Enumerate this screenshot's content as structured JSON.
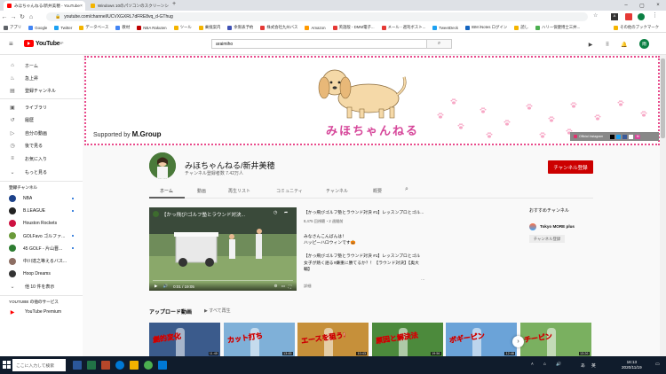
{
  "browser": {
    "tabs": [
      {
        "title": "みほちゃんねる/新井美穂 - YouTube",
        "active": true
      },
      {
        "title": "Windows 10のパソコンのスクリーンシ",
        "active": false
      }
    ],
    "url": "youtube.com/channel/UCVXGXRL7dFRE8vq_d-GThug",
    "bookmarks": [
      "アプリ",
      "Google",
      "Twitter",
      "データベース",
      "教材",
      "NBA Rakuten",
      "ツール",
      "乗換案内",
      "余限表予約",
      "株式会社九州バス",
      "Amazon",
      "英語版 - DMM電子...",
      "メール - 週刊ボスト...",
      "TweetDeck",
      "IBM iNotes ログイン",
      "読し",
      "ハリー保健博士三井...",
      "その他のブックマーク"
    ]
  },
  "youtube": {
    "logo_text": "YouTube",
    "logo_sup": "JP",
    "search_value": "araimiho",
    "avatar_letter": "雨"
  },
  "sidebar": {
    "main": [
      {
        "label": "ホーム",
        "icon": "home-icon",
        "glyph": "⌂",
        "active": false
      },
      {
        "label": "急上昇",
        "icon": "flame-icon",
        "glyph": "♨",
        "active": false
      },
      {
        "label": "登録チャンネル",
        "icon": "subscriptions-icon",
        "glyph": "▤",
        "active": false
      }
    ],
    "library": [
      {
        "label": "ライブラリ",
        "icon": "library-icon",
        "glyph": "▣"
      },
      {
        "label": "履歴",
        "icon": "history-icon",
        "glyph": "↺"
      },
      {
        "label": "自分の動画",
        "icon": "my-videos-icon",
        "glyph": "▷"
      },
      {
        "label": "後で見る",
        "icon": "watch-later-icon",
        "glyph": "◷"
      },
      {
        "label": "お気に入り",
        "icon": "favorites-icon",
        "glyph": "≡"
      },
      {
        "label": "もっと見る",
        "icon": "chevron-down-icon",
        "glyph": "⌄"
      }
    ],
    "subs_header": "登録チャンネル",
    "subs": [
      {
        "label": "NBA",
        "color": "#1d428a",
        "new": true
      },
      {
        "label": "B.LEAGUE",
        "color": "#222222",
        "new": true
      },
      {
        "label": "Houston Rockets",
        "color": "#ce1141",
        "new": false
      },
      {
        "label": "GOLFavo ゴルファ...",
        "color": "#6a9a3a",
        "new": true
      },
      {
        "label": "45 GOLF - 片山晋...",
        "color": "#2e7d32",
        "new": true
      },
      {
        "label": "中川達之等えるバス...",
        "color": "#8d6e63",
        "new": false
      },
      {
        "label": "Hoop Dreams",
        "color": "#333333",
        "new": false
      },
      {
        "label": "他 10 件を表示",
        "color": "",
        "new": false
      }
    ],
    "services_header": "YOUTUBE の他のサービス",
    "premium": "YouTube Premium"
  },
  "banner": {
    "supported_prefix": "Supported by",
    "supported_brand": "M.Group",
    "channel_art_name": "みほちゃんねる",
    "social_label": "Official Instagram",
    "social_letters": "M"
  },
  "channel": {
    "title": "みほちゃんねる/新井美穂",
    "subs": "チャンネル登録者数 7.42万人",
    "subscribe_label": "チャンネル登録",
    "tabs": [
      "ホーム",
      "動画",
      "再生リスト",
      "コミュニティ",
      "チャンネル",
      "概要"
    ],
    "active_tab": 0
  },
  "featured": {
    "player_title": "【かっ飛び!ゴルフ塾とラウンド対決...",
    "time": "0:01 / 19:05",
    "lines": [
      "【かっ飛びゴルフ塾とラウンド対決 #1】レッスンプロとゴル...",
      "8,475 回視聴・2 週間前",
      "みなさんこんばんは！",
      "ハッピーハロウィンです🎃",
      "【かっ飛びゴルフ塾とラウンド対決 #1】レッスンプロとゴル",
      "女子が熱く語る!!嫌重に勝てるか？！【ラウンド対決】【奥大",
      "輔】",
      "詳細"
    ],
    "more_dots": "⋯"
  },
  "related": {
    "header": "おすすめチャンネル",
    "channel_name": "Tokyo MORE plus",
    "subscribe_label": "チャンネル登録"
  },
  "uploads": {
    "header": "アップロード動画",
    "play_all": "すべて再生",
    "items": [
      {
        "caption": "劇的変化",
        "duration": "11:45",
        "bg": "#3b5b8c"
      },
      {
        "caption": "カット打ち",
        "duration": "13:45",
        "bg": "#7fb0d8"
      },
      {
        "caption": "エースを狙う!",
        "duration": "10:43",
        "bg": "#c6903a"
      },
      {
        "caption": "原因と解決法",
        "duration": "19:56",
        "bg": "#4c8a3c"
      },
      {
        "caption": "ボギーピン",
        "duration": "12:46",
        "bg": "#6ba3d8"
      },
      {
        "caption": "チーピン",
        "duration": "13:26",
        "bg": "#7ab060"
      }
    ]
  },
  "taskbar": {
    "search_placeholder": "ここに入力して検索",
    "time": "16:13",
    "date": "2020/11/19",
    "ime": "あ",
    "lang": "英"
  },
  "colors": {
    "accent_red": "#cc0000",
    "banner_pink": "#e94b8c",
    "name_pink": "#d6479a"
  }
}
